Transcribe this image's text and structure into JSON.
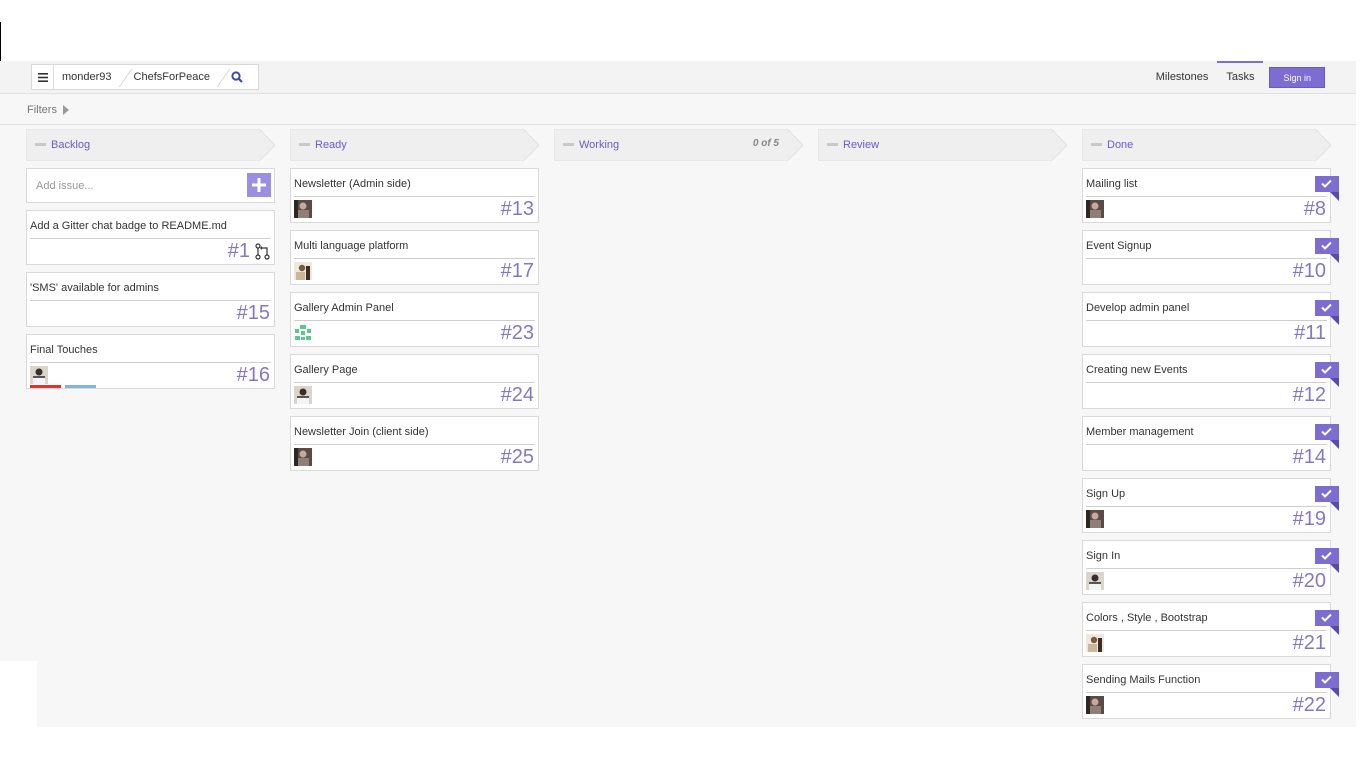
{
  "breadcrumb": {
    "user": "monder93",
    "repo": "ChefsForPeace"
  },
  "nav": {
    "milestones": "Milestones",
    "tasks": "Tasks",
    "signin": "Sign in"
  },
  "filters": {
    "label": "Filters"
  },
  "accent": "#7d6cd1",
  "columns": [
    {
      "title": "Backlog",
      "add_placeholder": "Add issue...",
      "cards": [
        {
          "title": "Add a Gitter chat badge to README.md",
          "number": "#1",
          "pr": true
        },
        {
          "title": "'SMS' available for admins",
          "number": "#15"
        },
        {
          "title": "Final Touches",
          "number": "#16",
          "avatar": "person",
          "labels": [
            "#e0332a",
            "#7fb6e0"
          ]
        }
      ]
    },
    {
      "title": "Ready",
      "cards": [
        {
          "title": "Newsletter (Admin side)",
          "number": "#13",
          "avatar": "person-dark"
        },
        {
          "title": "Multi language platform",
          "number": "#17",
          "avatar": "person-light"
        },
        {
          "title": "Gallery Admin Panel",
          "number": "#23",
          "avatar": "identicon"
        },
        {
          "title": "Gallery Page",
          "number": "#24",
          "avatar": "person"
        },
        {
          "title": "Newsletter Join (client side)",
          "number": "#25",
          "avatar": "person-dark"
        }
      ]
    },
    {
      "title": "Working",
      "count": "0 of 5",
      "cards": []
    },
    {
      "title": "Review",
      "cards": []
    },
    {
      "title": "Done",
      "cards": [
        {
          "title": "Mailing list",
          "number": "#8",
          "avatar": "person-dark"
        },
        {
          "title": "Event Signup",
          "number": "#10"
        },
        {
          "title": "Develop admin panel",
          "number": "#11"
        },
        {
          "title": "Creating new Events",
          "number": "#12"
        },
        {
          "title": "Member management",
          "number": "#14"
        },
        {
          "title": "Sign Up",
          "number": "#19",
          "avatar": "person-dark"
        },
        {
          "title": "Sign In",
          "number": "#20",
          "avatar": "person"
        },
        {
          "title": "Colors , Style , Bootstrap",
          "number": "#21",
          "avatar": "person-light"
        },
        {
          "title": "Sending Mails Function",
          "number": "#22",
          "avatar": "person-dark"
        }
      ]
    }
  ]
}
